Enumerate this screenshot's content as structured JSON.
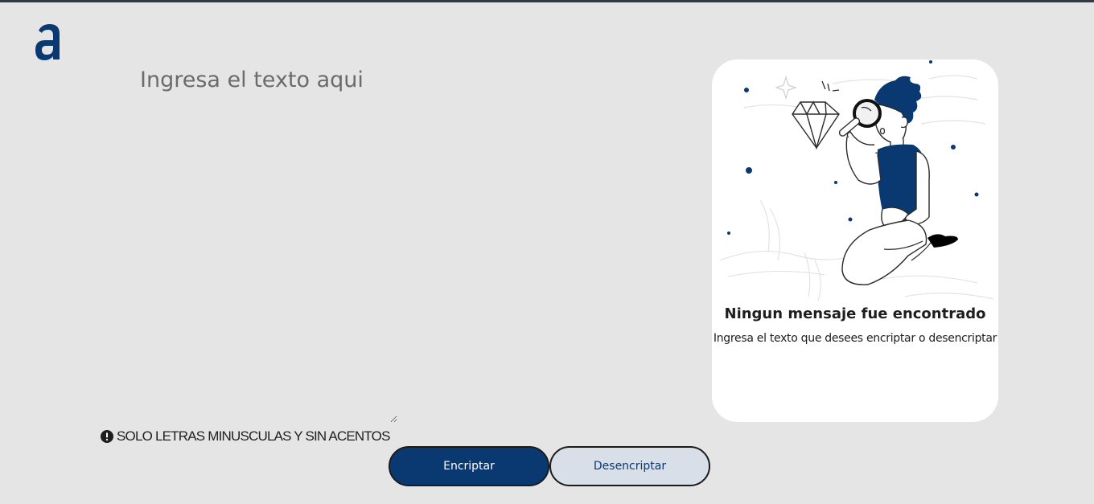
{
  "brand": {
    "accent_color": "#0a3871",
    "logo_icon": "alura-a-logo-icon"
  },
  "input": {
    "placeholder": "Ingresa el texto aqui",
    "value": ""
  },
  "notice": {
    "icon": "exclamation-circle-icon",
    "text": "SOLO LETRAS MINUSCULAS Y SIN ACENTOS"
  },
  "buttons": {
    "encrypt_label": "Encriptar",
    "decrypt_label": "Desencriptar",
    "encrypt_color": "#0a3871",
    "decrypt_color": "#d8dfe8"
  },
  "result": {
    "illustration": "person-with-magnifying-glass-illustration",
    "title": "Ningun mensaje fue encontrado",
    "subtitle": "Ingresa el texto que desees encriptar o desencriptar"
  }
}
